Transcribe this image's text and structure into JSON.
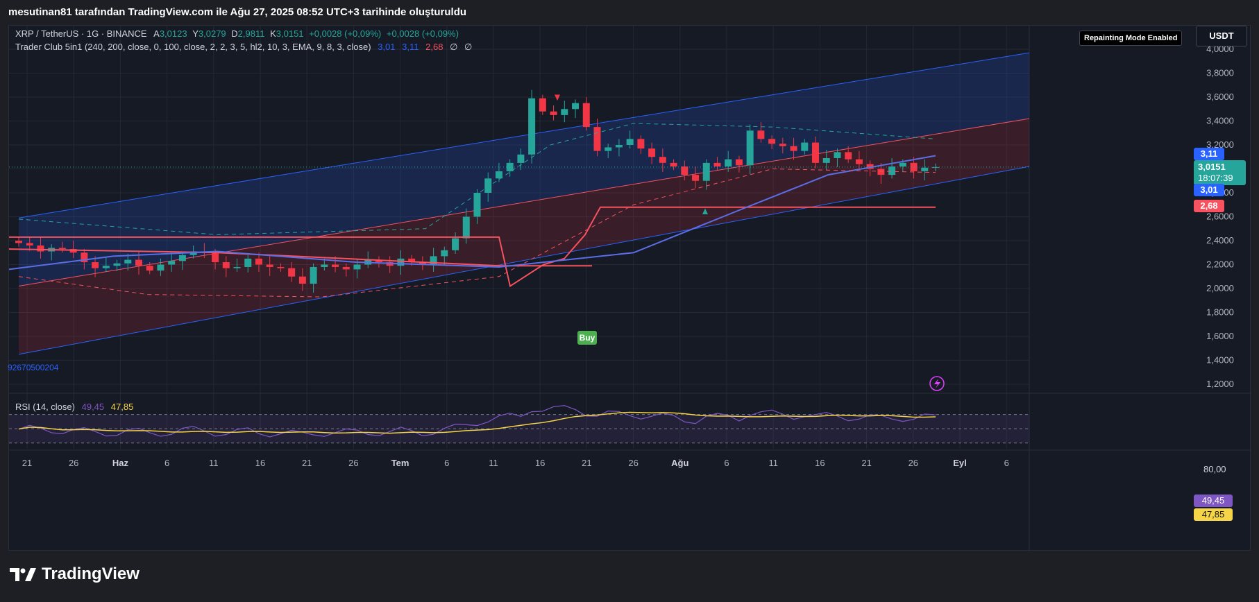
{
  "header": {
    "caption": "mesutinan81 tarafından TradingView.com ile Ağu 27, 2025 08:52 UTC+3 tarihinde oluşturuldu"
  },
  "legend": {
    "symbol": "XRP / TetherUS · 1G · BINANCE",
    "o_label": "A",
    "o_value": "3,0123",
    "h_label": "Y",
    "h_value": "3,0279",
    "l_label": "D",
    "l_value": "2,9811",
    "c_label": "K",
    "c_value": "3,0151",
    "change1": "+0,0028 (+0,09%)",
    "change2": "+0,0028 (+0,09%)",
    "indicator": "Trader Club 5in1 (240, 200, close, 0, 100, close, 2, 2, 3, 5, hl2, 10, 3, EMA, 9, 8, 3, close)",
    "ind_v1": "3,01",
    "ind_v2": "3,11",
    "ind_v3": "2,68",
    "ind_v4": "∅",
    "ind_v5": "∅",
    "side_value": "92670500204"
  },
  "badges": {
    "repaint": "Repainting Mode Enabled",
    "currency": "USDT",
    "buy": "Buy",
    "last_price": "3,0151",
    "countdown": "18:07:39",
    "upper": "3,11",
    "lower": "3,01",
    "support": "2,68"
  },
  "rsi": {
    "label": "RSI (14, close)",
    "value1": "49,45",
    "value2": "47,85",
    "axis_top": "80,00",
    "badge1": "49,45",
    "badge2": "47,85"
  },
  "colors": {
    "up": "#26a69a",
    "down": "#f23645",
    "channel": "#2962ff",
    "support": "#f7525f",
    "ma_blue": "#5b6ee8",
    "rsi_line": "#7e57c2",
    "rsi_ma": "#f5d547"
  },
  "branding": {
    "logo_text": "TradingView"
  },
  "chart_data": {
    "type": "line",
    "title": "XRP / TetherUS · 1G · BINANCE",
    "xlabel": "",
    "ylabel": "",
    "ylim": [
      1.1,
      4.05
    ],
    "y_ticks": [
      "4,0000",
      "3,8000",
      "3,6000",
      "3,4000",
      "3,2000",
      "3,0000",
      "2,8000",
      "2,6000",
      "2,4000",
      "2,2000",
      "2,0000",
      "1,8000",
      "1,6000",
      "1,4000",
      "1,2000"
    ],
    "x_ticks": [
      "21",
      "26",
      "Haz",
      "6",
      "11",
      "16",
      "21",
      "26",
      "Tem",
      "6",
      "11",
      "16",
      "21",
      "26",
      "Ağu",
      "6",
      "11",
      "16",
      "21",
      "26",
      "Eyl",
      "6"
    ],
    "series": [
      {
        "values": [
          2.38,
          2.36,
          2.31,
          2.34,
          2.33,
          2.3,
          2.22,
          2.17,
          2.19,
          2.21,
          2.24,
          2.19,
          2.15,
          2.2,
          2.23,
          2.28,
          2.31,
          2.3,
          2.22,
          2.17,
          2.18,
          2.25,
          2.2,
          2.18,
          2.17,
          2.1,
          2.04,
          2.18,
          2.2,
          2.18,
          2.16,
          2.2,
          2.24,
          2.22,
          2.19,
          2.25,
          2.22,
          2.2,
          2.27,
          2.32,
          2.42,
          2.6,
          2.8,
          2.92,
          2.98,
          3.05,
          3.12,
          3.59,
          3.48,
          3.45,
          3.5,
          3.55,
          3.35,
          3.15,
          3.18,
          3.2,
          3.25,
          3.17,
          3.1,
          3.05,
          3.02,
          2.95,
          2.9,
          3.05,
          3.02,
          3.08,
          3.03,
          3.32,
          3.25,
          3.21,
          3.19,
          3.15,
          3.22,
          3.05,
          3.09,
          3.14,
          3.08,
          3.04,
          3.0,
          2.95,
          3.02,
          3.05,
          2.98,
          3.01,
          3.0151
        ]
      },
      {
        "values": [
          3.01
        ]
      },
      {
        "values": [
          3.11
        ]
      },
      {
        "values": [
          2.68
        ]
      }
    ],
    "rsi_ylim": [
      20,
      90
    ],
    "rsi_levels": [
      70,
      50,
      30
    ]
  }
}
